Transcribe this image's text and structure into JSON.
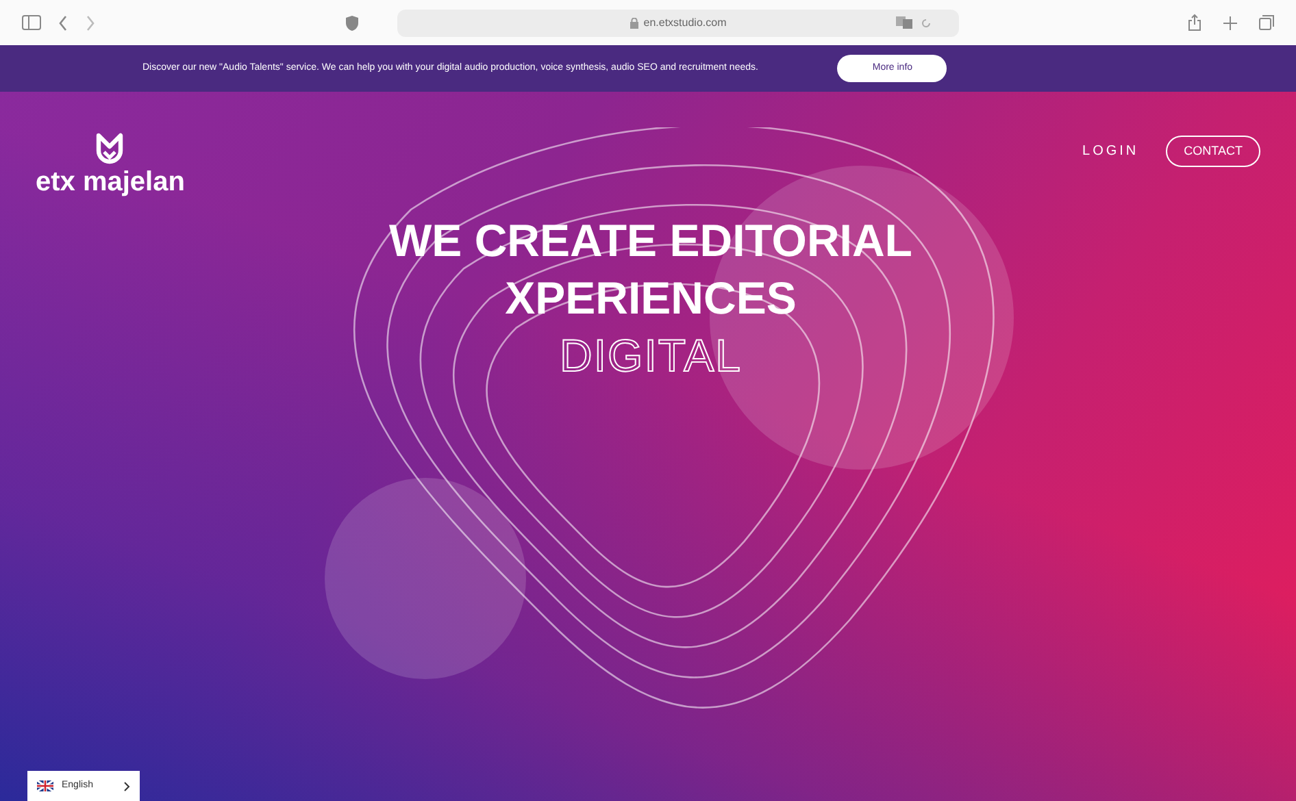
{
  "browser": {
    "url": "en.etxstudio.com"
  },
  "banner": {
    "text": "Discover our new \"Audio Talents\" service. We can help you with your digital audio production, voice synthesis, audio SEO and recruitment needs.",
    "button": "More info"
  },
  "logo": {
    "text": "etx majelan"
  },
  "nav": [
    {
      "label": "LOGIN",
      "kind": "link"
    },
    {
      "label": "CONTACT",
      "kind": "outlined"
    }
  ],
  "hero": {
    "lines": [
      {
        "text": "WE CREATE EDITORIAL",
        "kind": "solid"
      },
      {
        "text": "XPERIENCES",
        "kind": "solid"
      },
      {
        "text": "DIGITAL",
        "kind": "outline"
      }
    ]
  },
  "language": {
    "label": "English"
  }
}
